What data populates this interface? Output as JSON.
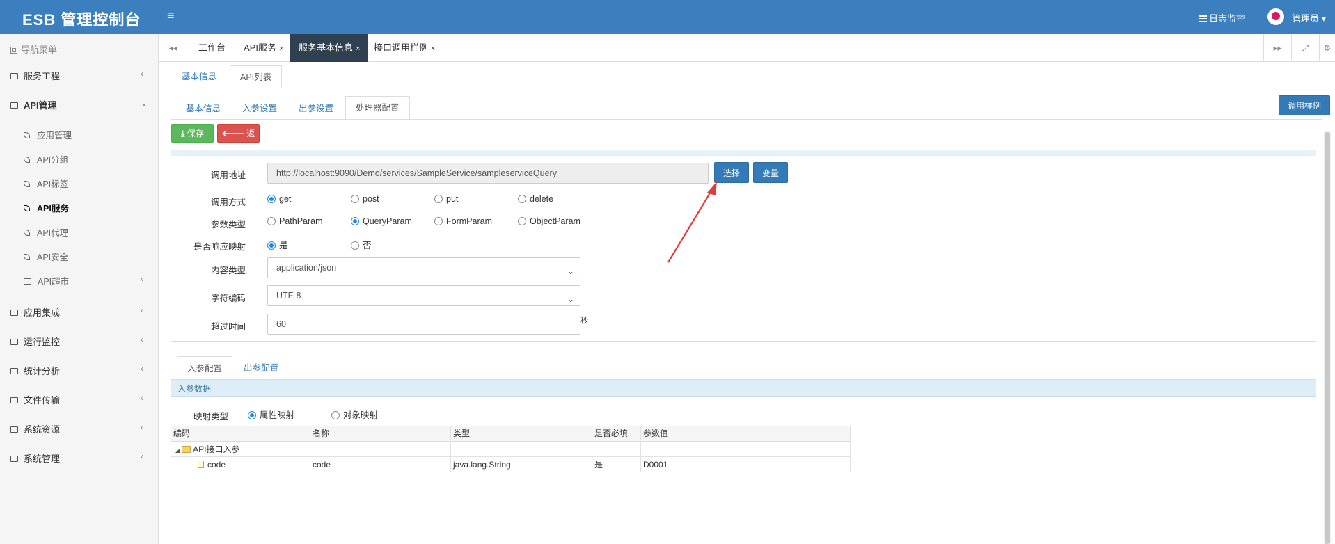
{
  "header": {
    "brand": "ESB 管理控制台",
    "menu_icon": "≡",
    "log_link": "日志监控",
    "user_name": "管理员 ▾"
  },
  "sidebar": {
    "header": "导航菜单",
    "items": [
      {
        "label": "服务工程"
      },
      {
        "label": "API管理"
      },
      {
        "label": "应用集成"
      },
      {
        "label": "运行监控"
      },
      {
        "label": "统计分析"
      },
      {
        "label": "文件传输"
      },
      {
        "label": "系统资源"
      },
      {
        "label": "系统管理"
      }
    ],
    "api_sub": [
      {
        "label": "应用管理"
      },
      {
        "label": "API分组"
      },
      {
        "label": "API标签"
      },
      {
        "label": "API服务"
      },
      {
        "label": "API代理"
      },
      {
        "label": "API安全"
      },
      {
        "label": "API超市"
      }
    ]
  },
  "tabs": [
    {
      "label": "工作台"
    },
    {
      "label": "API服务"
    },
    {
      "label": "服务基本信息"
    },
    {
      "label": "接口调用样例"
    }
  ],
  "tab_close": "×",
  "page_tabs": [
    "基本信息",
    "API列表"
  ],
  "inner_tabs": [
    "基本信息",
    "入参设置",
    "出参设置",
    "处理器配置"
  ],
  "buttons": {
    "call_example": "调用样例",
    "save": "保存",
    "back": "返回",
    "select": "选择",
    "variable": "变量"
  },
  "form": {
    "url_label": "调用地址",
    "url_value": "http://localhost:9090/Demo/services/SampleService/sampleserviceQuery",
    "method_label": "调用方式",
    "methods": [
      "get",
      "post",
      "put",
      "delete"
    ],
    "param_type_label": "参数类型",
    "param_types": [
      "PathParam",
      "QueryParam",
      "FormParam",
      "ObjectParam"
    ],
    "response_map_label": "是否响应映射",
    "yes": "是",
    "no": "否",
    "content_type_label": "内容类型",
    "content_type_value": "application/json",
    "charset_label": "字符编码",
    "charset_value": "UTF-8",
    "timeout_label": "超过时间",
    "timeout_value": "60",
    "timeout_unit": "秒"
  },
  "param_tabs": [
    "入参配置",
    "出参配置"
  ],
  "param_section_title": "入参数据",
  "map_type": {
    "label": "映射类型",
    "options": [
      "属性映射",
      "对象映射"
    ]
  },
  "table": {
    "headers": [
      "编码",
      "名称",
      "类型",
      "是否必填",
      "参数值"
    ],
    "rows": [
      {
        "code": "API接口入参",
        "name": "",
        "type": "",
        "required": "",
        "value": ""
      },
      {
        "code": "code",
        "name": "code",
        "type": "java.lang.String",
        "required": "是",
        "value": "D0001"
      }
    ]
  },
  "colors": {
    "header_bg": "#3c7fbf",
    "active_tab_bg": "#2f4050",
    "primary": "#337ab7",
    "success": "#5cb85c",
    "danger": "#d9534f",
    "annotation_arrow": "#e53935"
  },
  "icons": [
    "menu-icon",
    "list-icon",
    "avatar-icon",
    "folder-icon",
    "leaf-icon",
    "double-left-icon",
    "double-right-icon",
    "expand-icon",
    "gear-icon",
    "download-icon",
    "arrow-left-icon",
    "chevron-down-icon",
    "file-icon",
    "collapse-triangle-icon"
  ]
}
